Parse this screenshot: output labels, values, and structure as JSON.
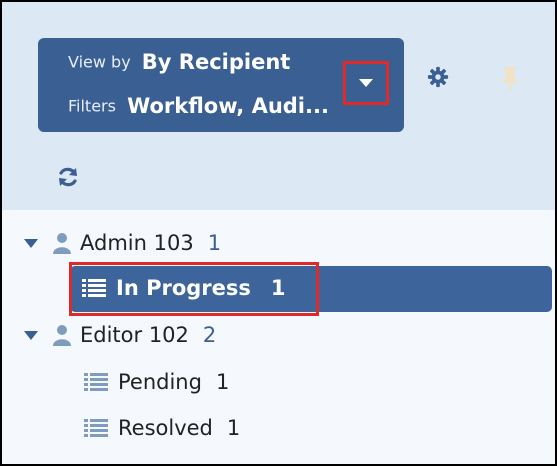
{
  "header": {
    "view_by_label": "View by",
    "view_by_value": "By Recipient",
    "filters_label": "Filters",
    "filters_value": "Workflow, Audi..."
  },
  "icons": {
    "dropdown": "chevron-down-icon",
    "settings": "gear-icon",
    "pin": "pin-icon",
    "refresh": "refresh-icon",
    "user": "user-icon",
    "list": "list-icon"
  },
  "colors": {
    "accent": "#395f93",
    "selected_row": "#3d659b",
    "highlight": "#e02a2a",
    "header_bg": "#dde8f5"
  },
  "tree": {
    "groups": [
      {
        "name": "Admin 103",
        "count": "1",
        "items": [
          {
            "label": "In Progress",
            "count": "1",
            "selected": true
          }
        ]
      },
      {
        "name": "Editor 102",
        "count": "2",
        "items": [
          {
            "label": "Pending",
            "count": "1"
          },
          {
            "label": "Resolved",
            "count": "1"
          }
        ]
      }
    ]
  }
}
